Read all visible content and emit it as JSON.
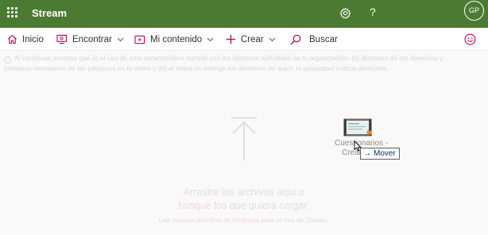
{
  "app": {
    "title": "Stream",
    "user_initials": "GP",
    "brand_color": "#4b7a33"
  },
  "topbar": {
    "settings_icon": "gear-icon",
    "help_icon": "question-mark-icon",
    "help_glyph": "?"
  },
  "nav": {
    "home_label": "Inicio",
    "discover_label": "Encontrar",
    "my_content_label": "Mi contenido",
    "create_label": "Crear",
    "search_placeholder": "Buscar",
    "feedback_icon": "smiley-icon",
    "accent_color": "#c30052"
  },
  "notice": {
    "line1": "Al continuar, aceptas que (i) el uso de esta característica cumple con los términos aplicables de tu organización, (ii) dispones de los derechos y",
    "line2": "permisos necesarios de las personas en tu vídeo y (iii) el vídeo no infringe los derechos de autor, la privacidad u otros derechos."
  },
  "upload": {
    "line1": "Arrastre los archivos aquí o",
    "line2_link": "busque",
    "line2_rest": " los que quiera cargar.",
    "line3_pre": "Lea nuestra directiva de ",
    "line3_link": "empresa",
    "line3_post": " para el uso de Stream."
  },
  "drag": {
    "file_name_line1": "Cuestionarios -",
    "file_name_line2": "Crear",
    "tooltip_label": "Mover",
    "tooltip_arrow": "→"
  }
}
